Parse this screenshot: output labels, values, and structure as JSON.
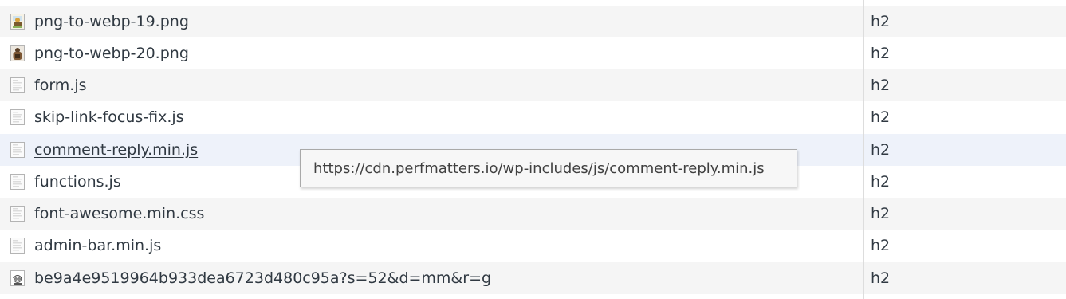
{
  "rows": [
    {
      "name": "",
      "protocol": "",
      "icon": "document-icon"
    },
    {
      "name": "png-to-webp-19.png",
      "protocol": "h2",
      "icon": "image-thumbnail-icon"
    },
    {
      "name": "png-to-webp-20.png",
      "protocol": "h2",
      "icon": "image-thumbnail-icon"
    },
    {
      "name": "form.js",
      "protocol": "h2",
      "icon": "script-file-icon"
    },
    {
      "name": "skip-link-focus-fix.js",
      "protocol": "h2",
      "icon": "script-file-icon"
    },
    {
      "name": "comment-reply.min.js",
      "protocol": "h2",
      "icon": "script-file-icon"
    },
    {
      "name": "functions.js",
      "protocol": "h2",
      "icon": "script-file-icon"
    },
    {
      "name": "font-awesome.min.css",
      "protocol": "h2",
      "icon": "stylesheet-file-icon"
    },
    {
      "name": "admin-bar.min.js",
      "protocol": "h2",
      "icon": "script-file-icon"
    },
    {
      "name": "be9a4e9519964b933dea6723d480c95a?s=52&d=mm&r=g",
      "protocol": "h2",
      "icon": "avatar-image-icon"
    }
  ],
  "tooltip": {
    "text": "https://cdn.perfmatters.io/wp-includes/js/comment-reply.min.js"
  }
}
